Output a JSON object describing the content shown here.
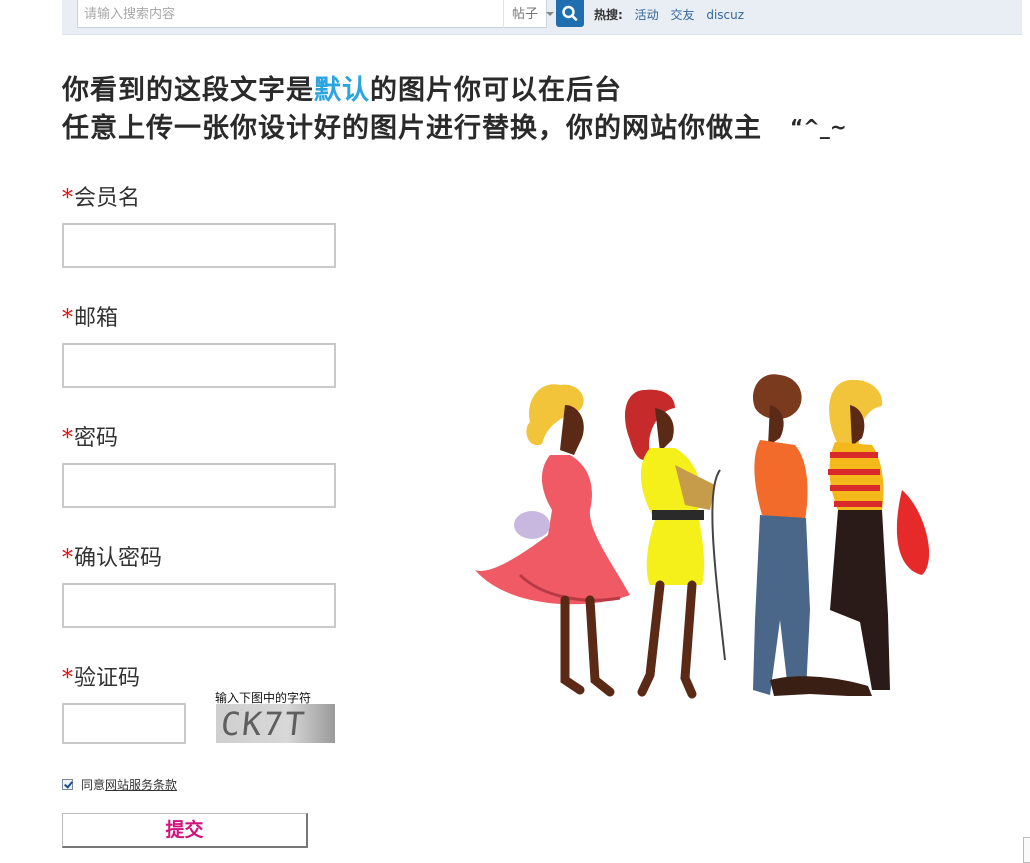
{
  "search": {
    "placeholder": "请输入搜索内容",
    "type_label": "帖子",
    "hot_title": "热搜:",
    "hot_links": [
      "活动",
      "交友",
      "discuz"
    ]
  },
  "slogan": {
    "line1_pre": "你看到的这段文字是",
    "line1_highlight": "默认",
    "line1_post": "的图片你可以在后台",
    "line2": "任意上传一张你设计好的图片进行替换，你的网站你做主",
    "emote": "“^_~"
  },
  "form": {
    "required_mark": "*",
    "username_label": "会员名",
    "email_label": "邮箱",
    "password_label": "密码",
    "confirm_label": "确认密码",
    "captcha_label": "验证码",
    "captcha_hint": "输入下图中的字符",
    "captcha_text": "CK7T",
    "agree_prefix": "同意",
    "agree_terms": "网站服务条款",
    "submit_label": "提交",
    "agree_checked": true
  },
  "colors": {
    "required": "#dd1111",
    "highlight": "#2aa5de",
    "submit_text": "#d0137c",
    "search_button": "#1f6fb0"
  },
  "icons": [
    "search-icon",
    "caret-down-icon",
    "checkbox-checked-icon"
  ]
}
